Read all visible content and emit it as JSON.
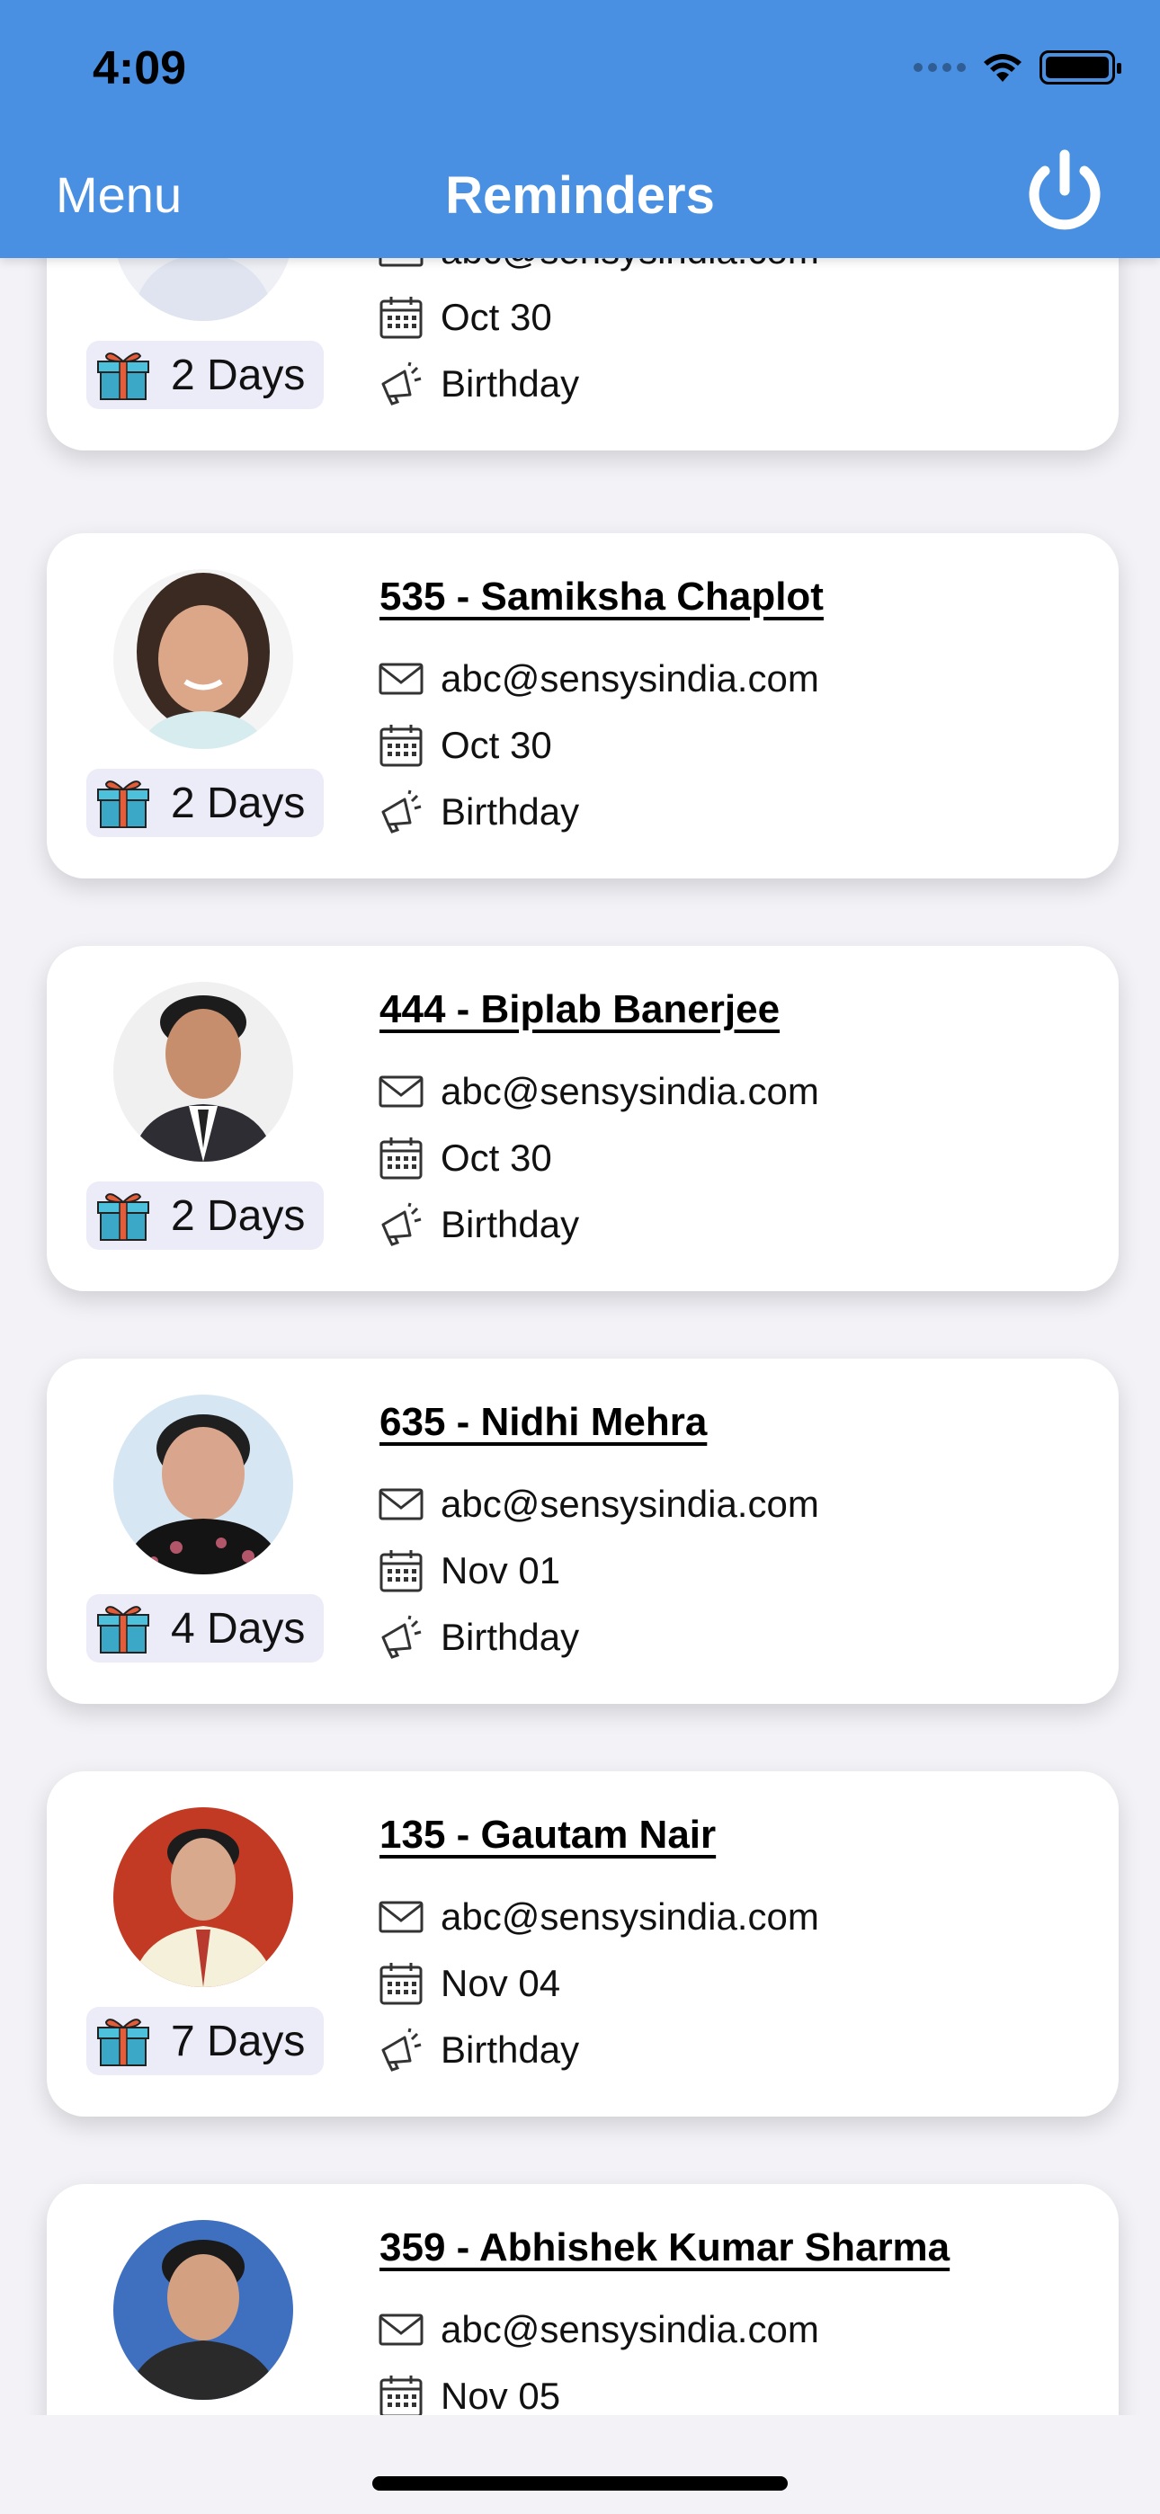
{
  "status_bar": {
    "time": "4:09"
  },
  "header": {
    "menu_label": "Menu",
    "title": "Reminders",
    "power_icon": "power-icon"
  },
  "colors": {
    "header_bg": "#4a90e2",
    "badge_bg": "#ecebf8",
    "card_bg": "#ffffff"
  },
  "reminders": [
    {
      "name": "",
      "email": "abc@sensysindia.com",
      "date": "Oct 30",
      "type": "Birthday",
      "days": "2 Days"
    },
    {
      "name": "535 - Samiksha  Chaplot",
      "email": "abc@sensysindia.com",
      "date": "Oct 30",
      "type": "Birthday",
      "days": "2 Days"
    },
    {
      "name": "444 - Biplab  Banerjee",
      "email": "abc@sensysindia.com",
      "date": "Oct 30",
      "type": "Birthday",
      "days": "2 Days"
    },
    {
      "name": "635 - Nidhi  Mehra",
      "email": "abc@sensysindia.com",
      "date": "Nov 01",
      "type": "Birthday",
      "days": "4 Days"
    },
    {
      "name": "135 - Gautam  Nair",
      "email": "abc@sensysindia.com",
      "date": "Nov 04",
      "type": "Birthday",
      "days": "7 Days"
    },
    {
      "name": "359 - Abhishek Kumar  Sharma",
      "email": "abc@sensysindia.com",
      "date": "Nov 05",
      "type": "",
      "days": ""
    }
  ]
}
